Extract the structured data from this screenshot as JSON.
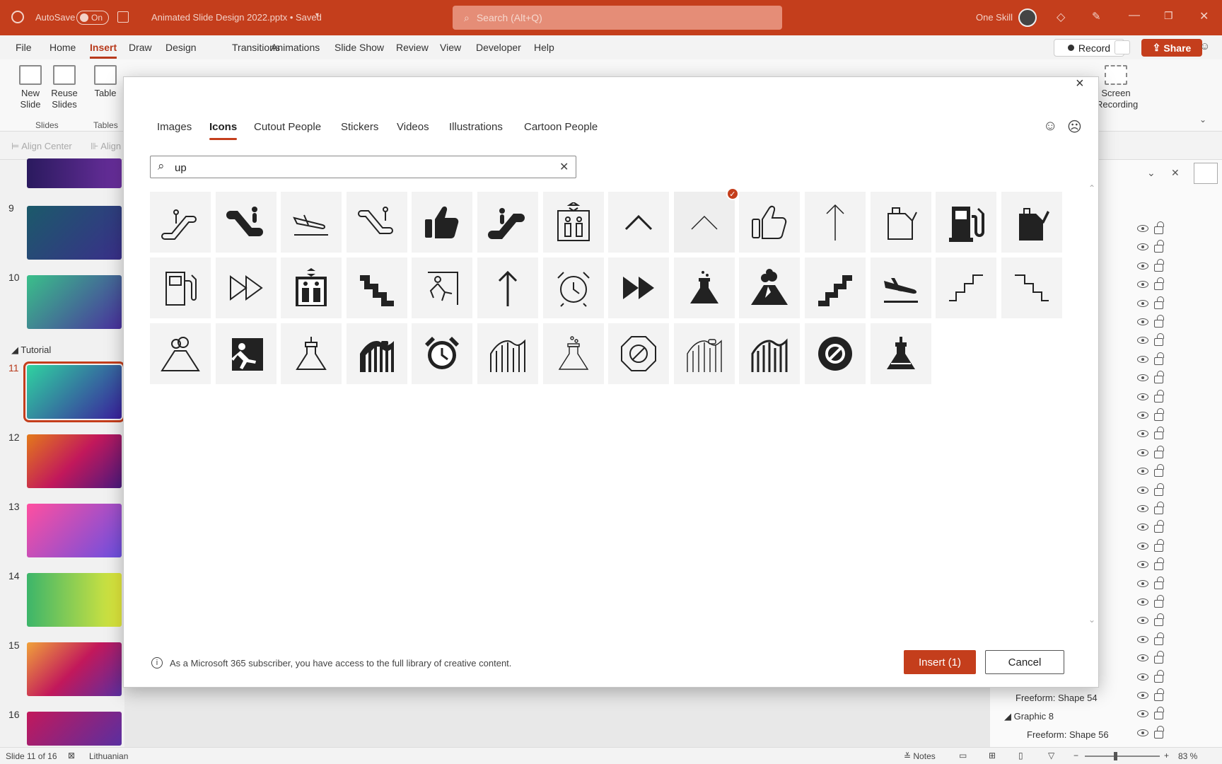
{
  "titlebar": {
    "autosave_label": "AutoSave",
    "autosave_state": "On",
    "filename": "Animated Slide Design 2022.pptx • Saved",
    "search_placeholder": "Search (Alt+Q)",
    "user_name": "One Skill"
  },
  "menu": {
    "items": [
      "File",
      "Home",
      "Insert",
      "Draw",
      "Design",
      "Transitions",
      "Animations",
      "Slide Show",
      "Review",
      "View",
      "Developer",
      "Help"
    ],
    "active": "Insert",
    "record_label": "Record",
    "share_label": "Share"
  },
  "ribbon": {
    "new_slide": "New\nSlide",
    "reuse_slides": "Reuse\nSlides",
    "table": "Table",
    "slides_group": "Slides",
    "tables_group": "Tables",
    "screen_recording": "Screen\nRecording",
    "align_center": "Align Center",
    "align_more": "Align"
  },
  "slides_panel": {
    "section_name": "Tutorial",
    "slide_numbers": [
      "9",
      "10",
      "11",
      "12",
      "13",
      "14",
      "15",
      "16"
    ],
    "selected": "11"
  },
  "dialog": {
    "tabs": [
      "Images",
      "Icons",
      "Cutout People",
      "Stickers",
      "Videos",
      "Illustrations",
      "Cartoon People"
    ],
    "active_tab": "Icons",
    "search_value": "up",
    "icons_row1": [
      "escalator-up-outline-icon",
      "escalator-down-filled-icon",
      "airplane-landing-outline-icon",
      "escalator-down-outline-icon",
      "thumbs-up-filled-icon",
      "escalator-up-filled-icon",
      "elevator-outline-icon",
      "chevron-up-icon",
      "chevron-up-thin-icon",
      "thumbs-up-outline-icon",
      "arrow-up-thin-icon",
      "fuel-can-outline-icon",
      "fuel-pump-filled-icon",
      "fuel-can-filled-icon"
    ],
    "icons_row2": [
      "fuel-pump-outline-icon",
      "fast-forward-outline-icon",
      "elevator-filled-icon",
      "stairs-down-filled-icon",
      "climber-outline-icon",
      "arrow-up-icon",
      "alarm-clock-outline-icon",
      "fast-forward-filled-icon",
      "potion-filled-icon",
      "volcano-filled-icon",
      "stairs-up-filled-icon",
      "airplane-landing-filled-icon",
      "stairs-up-outline-icon",
      "stairs-down-outline-icon"
    ],
    "icons_row3": [
      "volcano-outline-icon",
      "climber-filled-icon",
      "potion-outline-icon",
      "roller-coaster-filled-icon",
      "alarm-clock-filled-icon",
      "roller-coaster-outline-icon",
      "potion-thin-icon",
      "no-entry-outline-icon",
      "roller-coaster-thin-icon",
      "roller-coaster-bold-icon",
      "no-entry-filled-icon",
      "potion-bold-icon"
    ],
    "selected_icon": "chevron-up-thin-icon",
    "footer_note": "As a Microsoft 365 subscriber, you have access to the full library of creative content.",
    "insert_label": "Insert (1)",
    "cancel_label": "Cancel"
  },
  "selection_pane": {
    "items": [
      "Freeform: Shape 54",
      "Graphic 8",
      "Freeform: Shape 56"
    ]
  },
  "statusbar": {
    "slide_info": "Slide 11 of 16",
    "language": "Lithuanian",
    "notes_label": "Notes",
    "zoom": "83 %"
  },
  "colors": {
    "accent": "#c43e1c",
    "titlebar": "#c43e1c"
  }
}
